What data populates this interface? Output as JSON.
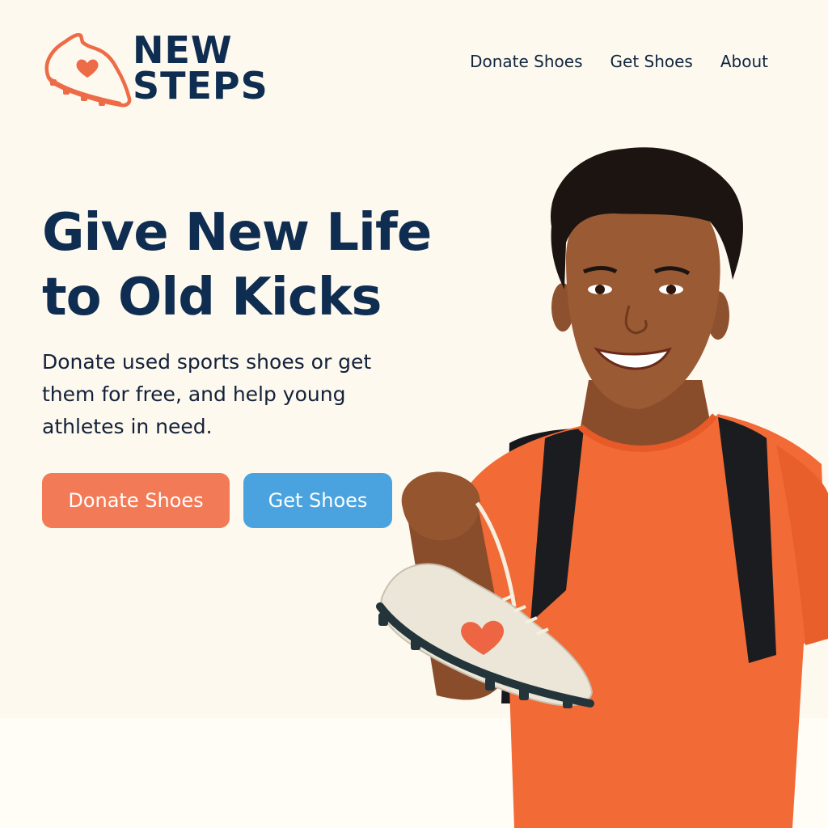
{
  "brand": {
    "line1": "NEW",
    "line2": "STEPS",
    "logo_icon": "shoe-heart-icon",
    "colors": {
      "navy": "#0f2d50",
      "orange": "#f27a56",
      "blue": "#4aa3df",
      "background": "#fdf9ee"
    }
  },
  "nav": {
    "items": [
      {
        "label": "Donate Shoes"
      },
      {
        "label": "Get Shoes"
      },
      {
        "label": "About"
      }
    ]
  },
  "hero": {
    "headline": "Give New Life to Old Kicks",
    "subtext": "Donate used sports shoes or get them for free, and help young athletes in need.",
    "primary_button": "Donate Shoes",
    "secondary_button": "Get Shoes",
    "image": "boy-holding-cleat-photo"
  }
}
